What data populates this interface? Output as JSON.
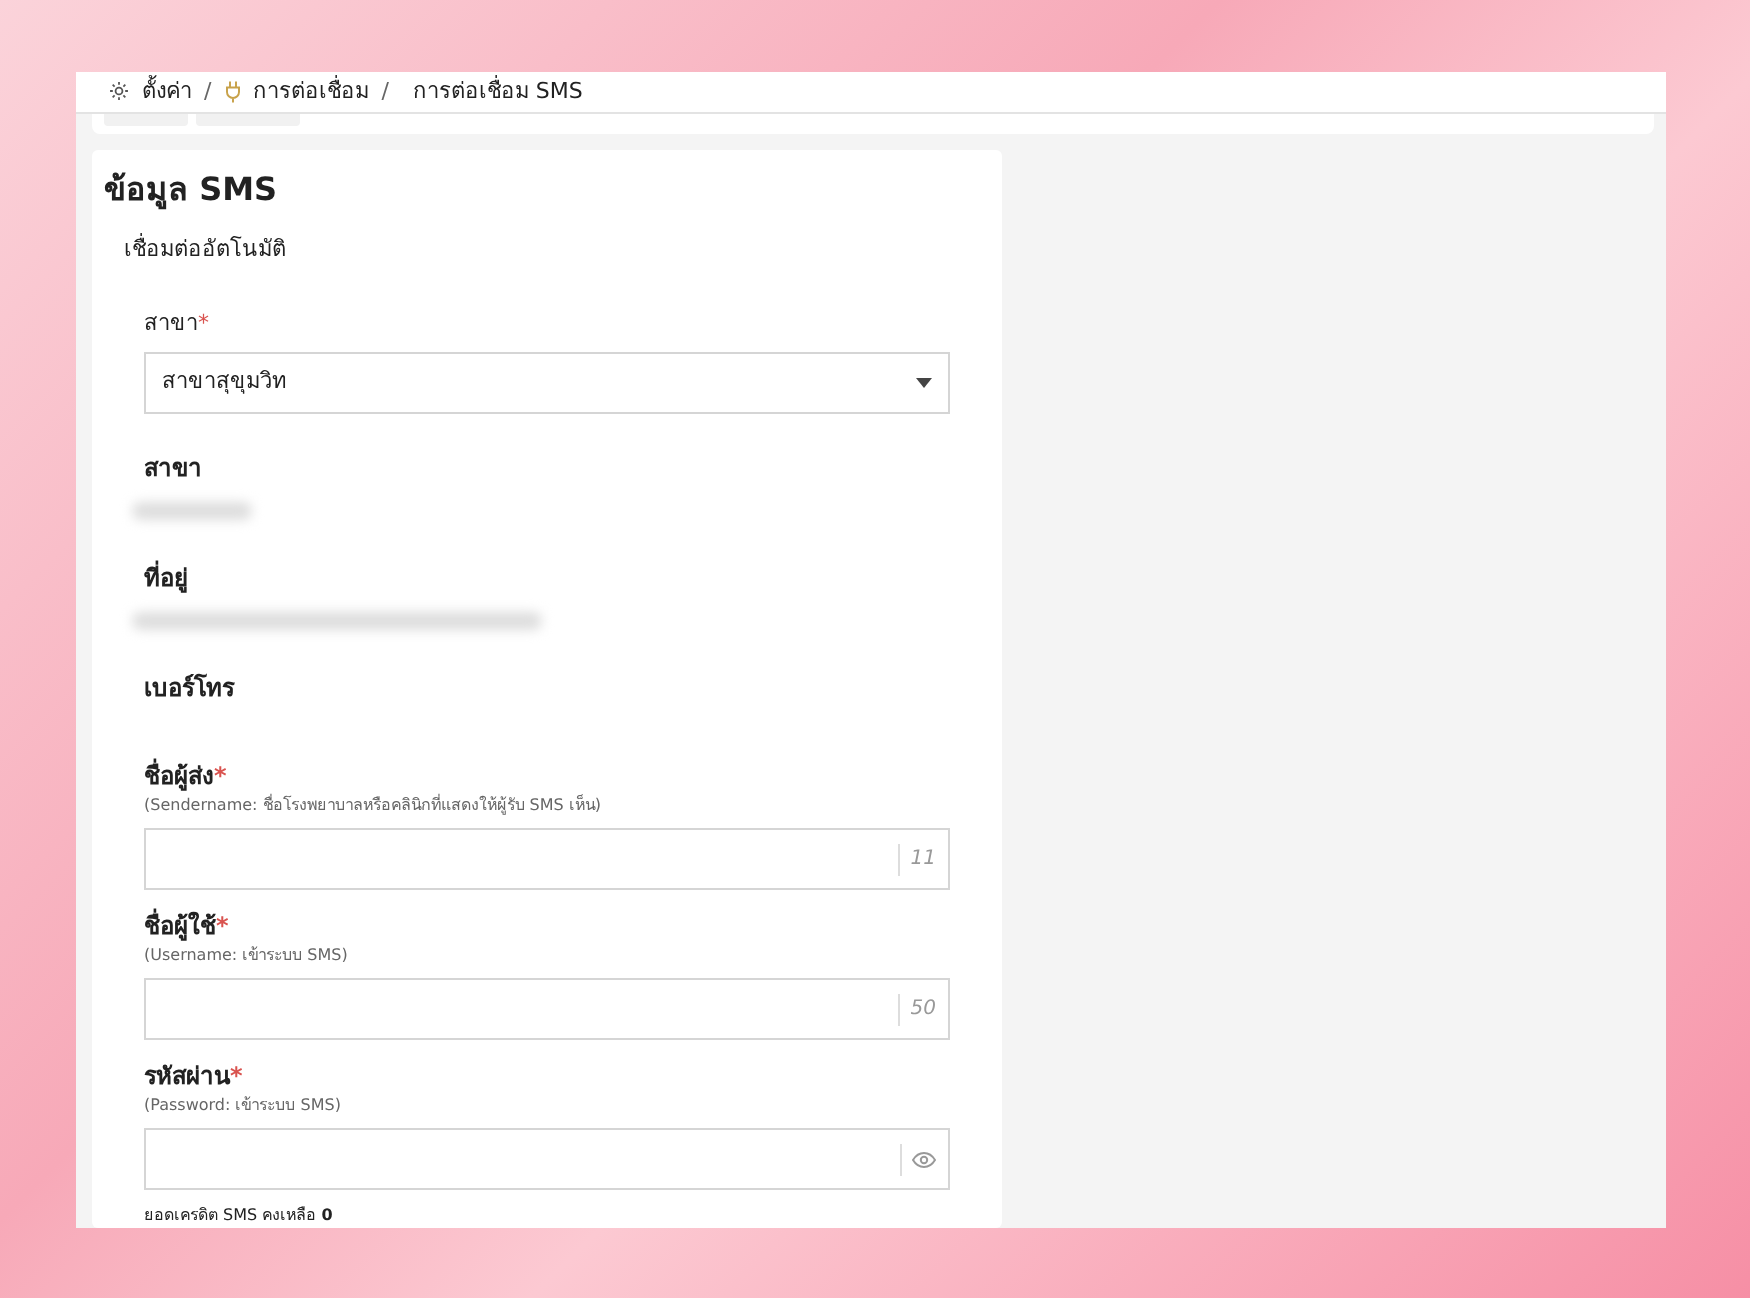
{
  "breadcrumb": [
    {
      "label": "ตั้งค่า",
      "separator": "/"
    },
    {
      "label": "การต่อเชื่อม",
      "separator": "/"
    },
    {
      "label": "การต่อเชื่อม SMS"
    }
  ],
  "card": {
    "title": "ข้อมูล SMS",
    "subtitle": "เชื่อมต่ออัตโนมัติ",
    "fields": [
      {
        "kind": "select",
        "label": "สาขา",
        "required_mark": "*",
        "value": "สาขาสุขุมวิท"
      },
      {
        "kind": "redacted",
        "label": "สาขา"
      },
      {
        "kind": "redacted",
        "label": "ที่อยู่"
      },
      {
        "kind": "info",
        "label": "เบอร์โทร"
      },
      {
        "kind": "input",
        "label": "ชื่อผู้ส่ง",
        "required_mark": "*",
        "hint": "(Sendername: ชื่อโรงพยาบาลหรือคลินิกที่แสดงให้ผู้รับ SMS เห็น)",
        "suffix": "11"
      },
      {
        "kind": "input",
        "label": "ชื่อผู้ใช้",
        "required_mark": "*",
        "hint": "(Username: เข้าระบบ SMS)",
        "suffix": "50"
      },
      {
        "kind": "password",
        "label": "รหัสผ่าน",
        "required_mark": "*",
        "hint": "(Password: เข้าระบบ SMS)"
      }
    ],
    "credit": "ยอดเครดิต SMS คงเหลือ **0**"
  }
}
